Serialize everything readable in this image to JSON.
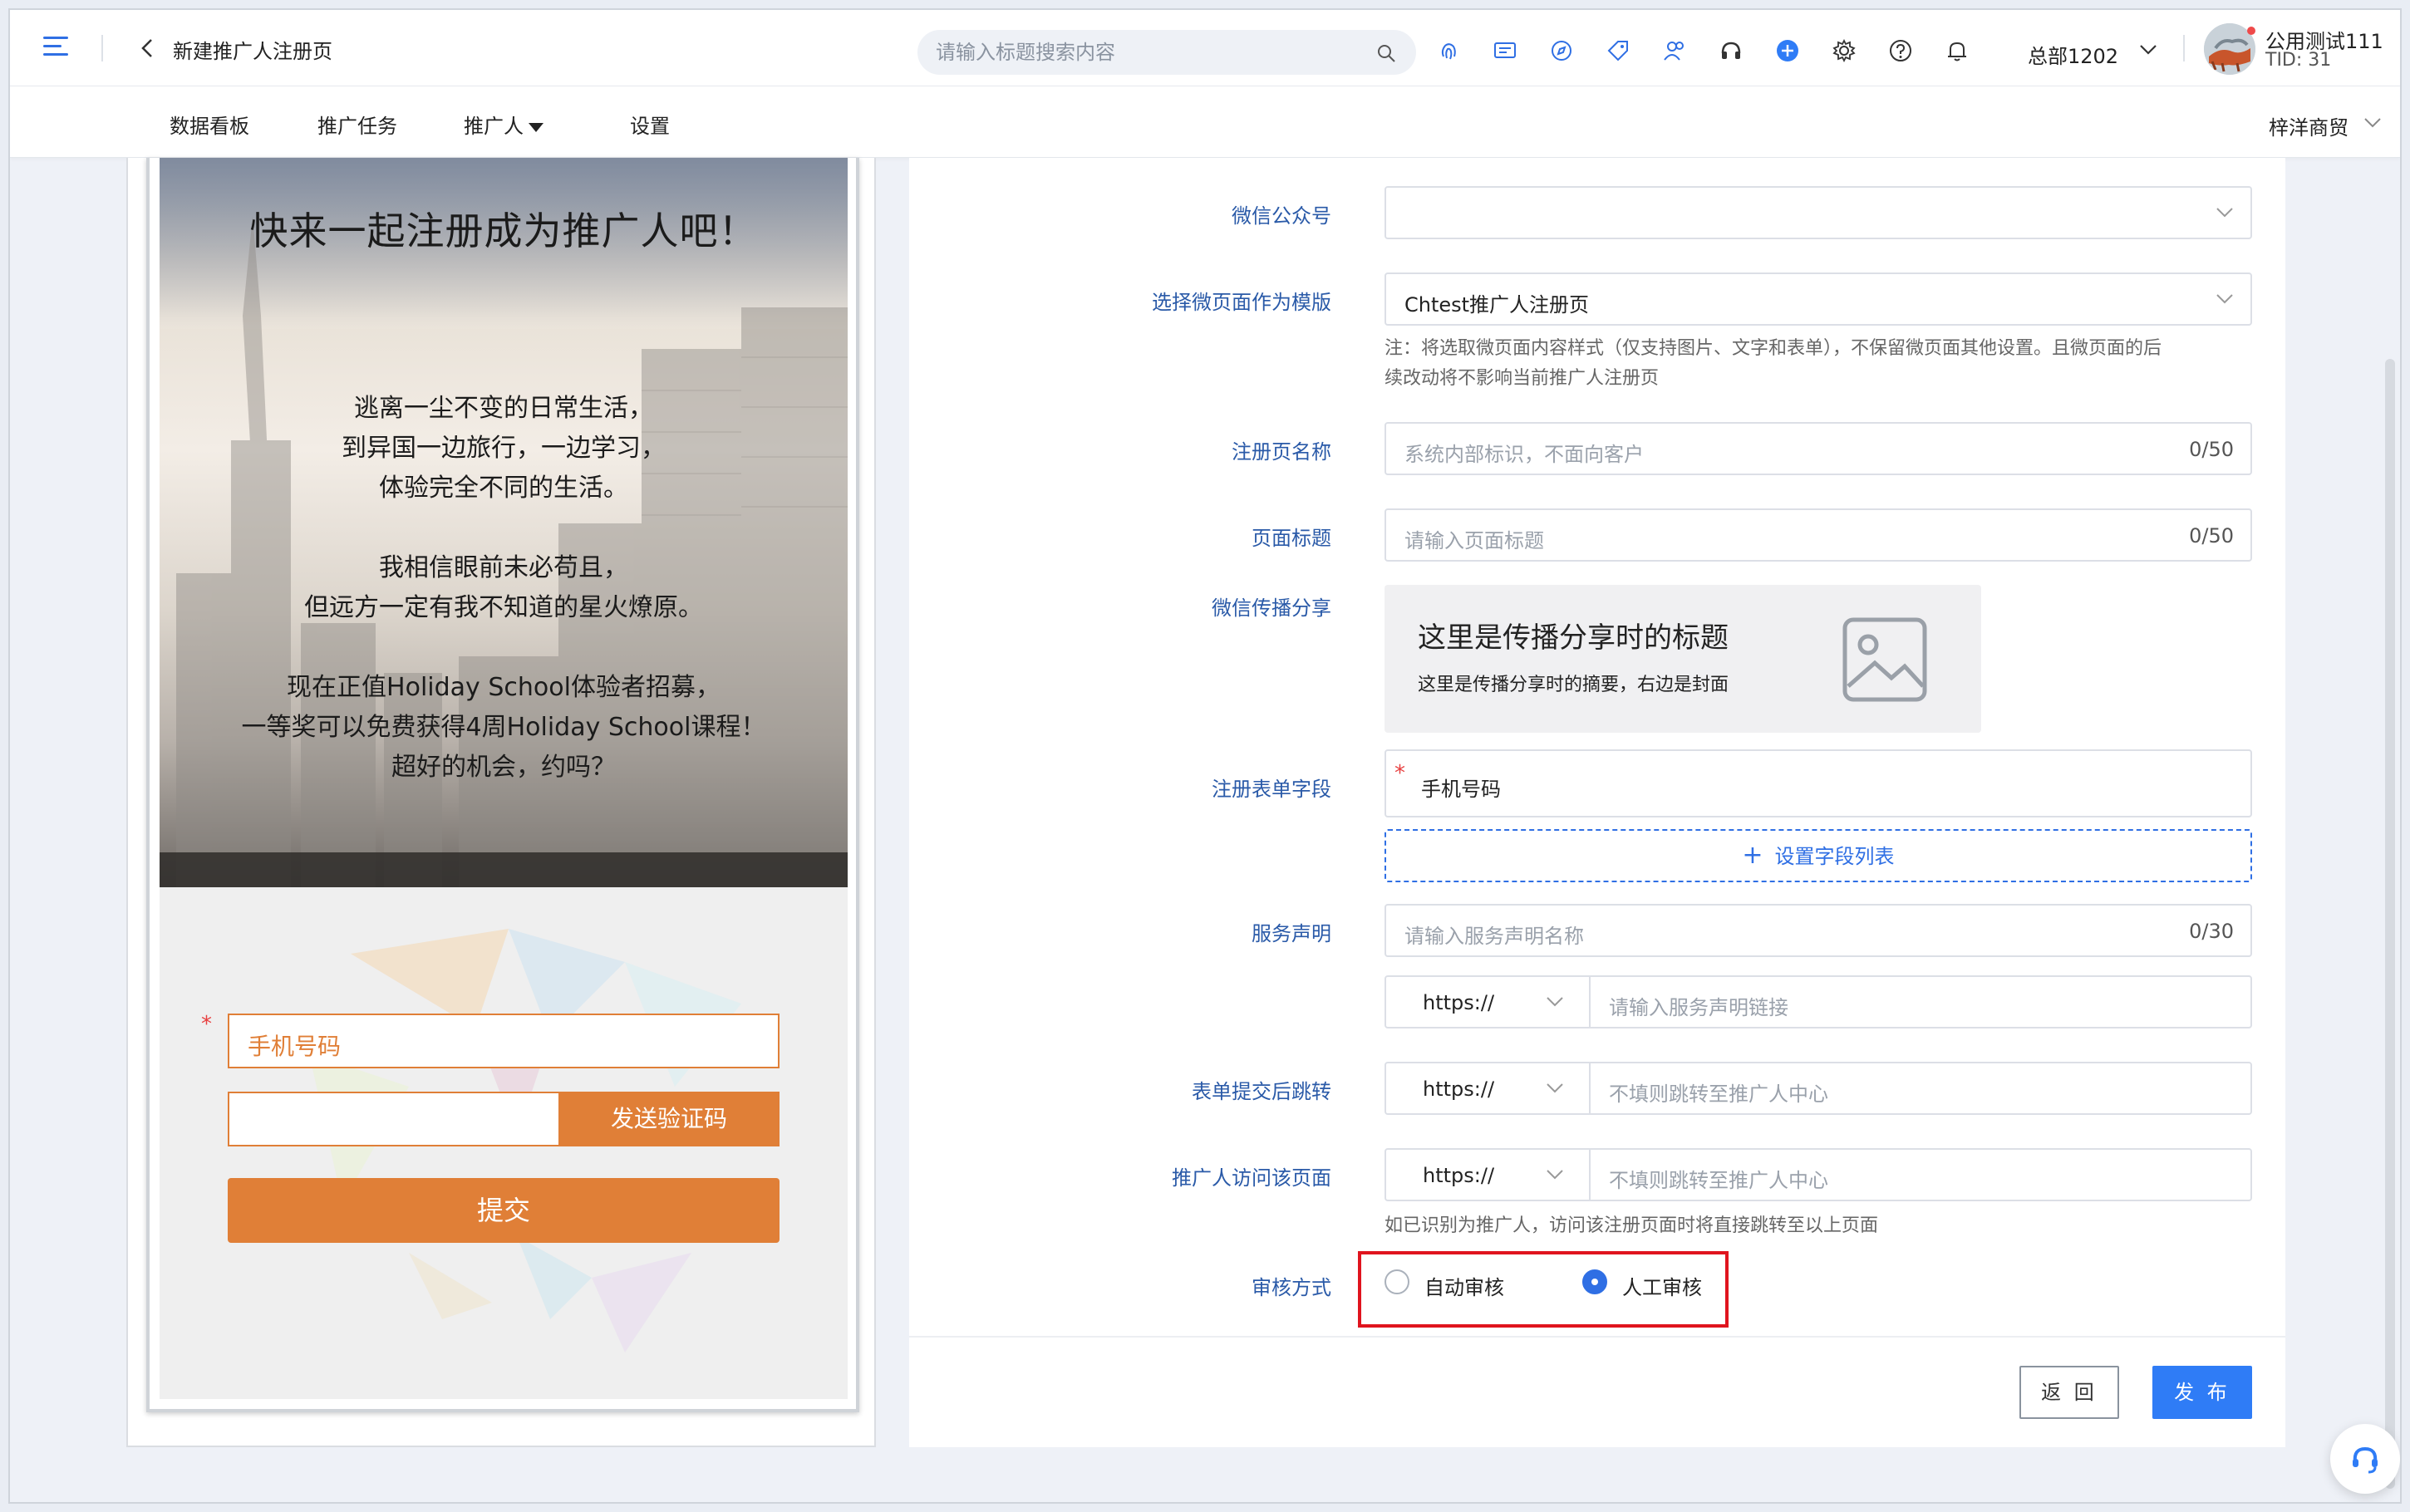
{
  "header": {
    "page_title": "新建推广人注册页",
    "search_placeholder": "请输入标题搜索内容",
    "toolbar_icons": [
      "fingerprint-icon",
      "message-icon",
      "compass-icon",
      "tag-icon",
      "users-icon",
      "headset-icon",
      "plus-circle-icon",
      "gear-icon",
      "help-icon",
      "bell-icon"
    ],
    "org_label": "总部1202",
    "user_name": "公用测试111",
    "user_tid": "TID: 31"
  },
  "nav": {
    "items": [
      {
        "label": "数据看板"
      },
      {
        "label": "推广任务"
      },
      {
        "label": "推广人"
      },
      {
        "label": "设置"
      }
    ],
    "shop_label": "梓洋商贸"
  },
  "preview": {
    "hero_title": "快来一起注册成为推广人吧！",
    "lines": [
      "逃离一尘不变的日常生活，",
      "到异国一边旅行，一边学习，",
      "体验完全不同的生活。",
      "我相信眼前未必苟且，",
      "但远方一定有我不知道的星火燎原。",
      "现在正值Holiday School体验者招募，",
      "一等奖可以免费获得4周Holiday School课程！",
      "超好的机会，约吗？"
    ],
    "phone_placeholder": "手机号码",
    "send_code_label": "发送验证码",
    "submit_label": "提交"
  },
  "form": {
    "wechat_account": {
      "label": "微信公众号",
      "value": ""
    },
    "template": {
      "label": "选择微页面作为模版",
      "value": "Chtest推广人注册页",
      "note_line1": "注：将选取微页面内容样式（仅支持图片、文字和表单），不保留微页面其他设置。且微页面的后",
      "note_line2": "续改动将不影响当前推广人注册页"
    },
    "page_name": {
      "label": "注册页名称",
      "placeholder": "系统内部标识，不面向客户",
      "count": "0/50"
    },
    "page_title": {
      "label": "页面标题",
      "placeholder": "请输入页面标题",
      "count": "0/50"
    },
    "share": {
      "label": "微信传播分享",
      "title": "这里是传播分享时的标题",
      "summary": "这里是传播分享时的摘要，右边是封面"
    },
    "fields": {
      "label": "注册表单字段",
      "item": "手机号码",
      "set_button": "设置字段列表"
    },
    "service": {
      "label": "服务声明",
      "name_placeholder": "请输入服务声明名称",
      "count": "0/30",
      "protocol": "https://",
      "link_placeholder": "请输入服务声明链接"
    },
    "redirect_after_submit": {
      "label": "表单提交后跳转",
      "protocol": "https://",
      "placeholder": "不填则跳转至推广人中心"
    },
    "promoter_visit": {
      "label": "推广人访问该页面",
      "protocol": "https://",
      "placeholder": "不填则跳转至推广人中心",
      "note": "如已识别为推广人，访问该注册页面时将直接跳转至以上页面"
    },
    "review": {
      "label": "审核方式",
      "options": [
        {
          "label": "自动审核",
          "checked": false
        },
        {
          "label": "人工审核",
          "checked": true
        }
      ]
    }
  },
  "actions": {
    "back_label": "返 回",
    "publish_label": "发 布"
  },
  "colors": {
    "accent": "#2f7cf6",
    "brand_orange": "#e07f37",
    "highlight": "#e0141e"
  }
}
